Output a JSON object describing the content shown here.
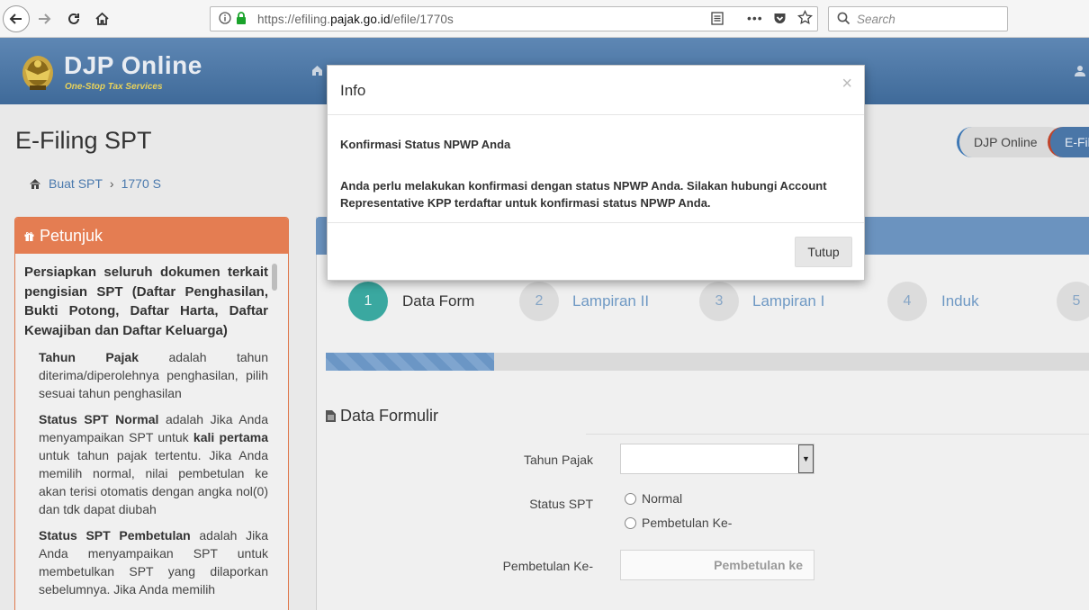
{
  "browser": {
    "url_prefix": "https://efiling.",
    "url_domain": "pajak.go.id",
    "url_path": "/efile/1770s",
    "search_placeholder": "Search"
  },
  "header": {
    "brand": "DJP Online",
    "tagline": "One-Stop Tax Services"
  },
  "page": {
    "title": "E-Filing SPT",
    "breadcrumb": [
      "Buat SPT",
      "1770 S"
    ],
    "pills": [
      "DJP Online",
      "E-Fili"
    ]
  },
  "petunjuk": {
    "heading": "Petunjuk",
    "lead": "Persiapkan seluruh dokumen terkait pengisian SPT (Daftar Penghasilan, Bukti Potong, Daftar Harta, Daftar Kewajiban dan Daftar Keluarga)",
    "tahun_term": "Tahun Pajak",
    "tahun_text": " adalah tahun diterima/diperolehnya penghasilan, pilih sesuai tahun penghasilan",
    "normal_term": "Status SPT Normal",
    "normal_text_1": " adalah Jika Anda menyampaikan SPT untuk ",
    "normal_em": "kali pertama",
    "normal_text_2": " untuk tahun pajak tertentu. Jika Anda memilih normal, nilai pembetulan ke akan terisi otomatis dengan angka nol(0) dan tdk dapat diubah",
    "pembetulan_term": "Status SPT Pembetulan",
    "pembetulan_text": " adalah Jika Anda menyampaikan SPT untuk membetulkan SPT yang dilaporkan sebelumnya. Jika Anda memilih"
  },
  "steps": [
    {
      "num": "1",
      "label": "Data Form"
    },
    {
      "num": "2",
      "label": "Lampiran II"
    },
    {
      "num": "3",
      "label": "Lampiran I"
    },
    {
      "num": "4",
      "label": "Induk"
    },
    {
      "num": "5",
      "label": ""
    }
  ],
  "progress": {
    "fraction": 0.22
  },
  "form": {
    "section_title": "Data Formulir",
    "tahun_label": "Tahun Pajak",
    "tahun_value": "",
    "status_label": "Status SPT",
    "status_options": [
      "Normal",
      "Pembetulan Ke-"
    ],
    "pembetulan_label": "Pembetulan Ke-",
    "pembetulan_placeholder": "Pembetulan ke"
  },
  "modal": {
    "title": "Info",
    "close": "×",
    "subject": "Konfirmasi Status NPWP Anda",
    "message": "Anda perlu melakukan konfirmasi dengan status NPWP Anda. Silakan hubungi Account Representative KPP terdaftar untuk konfirmasi status NPWP Anda.",
    "button": "Tutup"
  },
  "colors": {
    "header_blue": "#4f79a8",
    "petunjuk_orange": "#e47d52",
    "step_active": "#3aa8a0",
    "link_blue": "#4a79ad"
  }
}
